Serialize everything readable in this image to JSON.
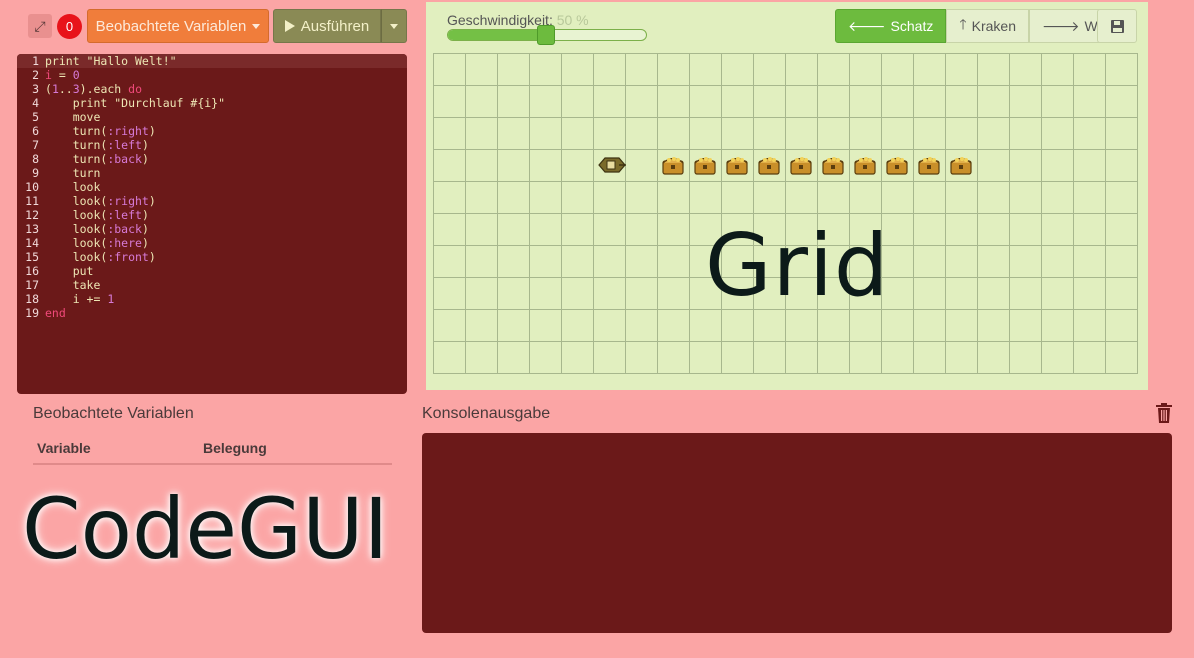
{
  "toolbar": {
    "error_count": "0",
    "watch_button_label": "Beobachtete Variablen",
    "run_button_label": "Ausführen"
  },
  "editor": {
    "lines": [
      {
        "n": "1",
        "html": "<span class=\"kw\"></span>print \"Hallo Welt!\""
      },
      {
        "n": "2",
        "html": "<span class=\"kw\">i</span> = <span class=\"num\">0</span>"
      },
      {
        "n": "3",
        "html": "(<span class=\"num\">1</span>..<span class=\"num\">3</span>).each <span class=\"kw\">do</span>"
      },
      {
        "n": "4",
        "html": "    print \"Durchlauf #{i}\""
      },
      {
        "n": "5",
        "html": "    move"
      },
      {
        "n": "6",
        "html": "    turn(<span class=\"sym\">:right</span>)"
      },
      {
        "n": "7",
        "html": "    turn(<span class=\"sym\">:left</span>)"
      },
      {
        "n": "8",
        "html": "    turn(<span class=\"sym\">:back</span>)"
      },
      {
        "n": "9",
        "html": "    turn"
      },
      {
        "n": "10",
        "html": "    look"
      },
      {
        "n": "11",
        "html": "    look(<span class=\"sym\">:right</span>)"
      },
      {
        "n": "12",
        "html": "    look(<span class=\"sym\">:left</span>)"
      },
      {
        "n": "13",
        "html": "    look(<span class=\"sym\">:back</span>)"
      },
      {
        "n": "14",
        "html": "    look(<span class=\"sym\">:here</span>)"
      },
      {
        "n": "15",
        "html": "    look(<span class=\"sym\">:front</span>)"
      },
      {
        "n": "16",
        "html": "    put"
      },
      {
        "n": "17",
        "html": "    take"
      },
      {
        "n": "18",
        "html": "    i += <span class=\"num\">1</span>"
      },
      {
        "n": "19",
        "html": "<span class=\"kw\">end</span>"
      }
    ]
  },
  "grid": {
    "speed_label": "Geschwindigkeit:",
    "speed_value": "50 %",
    "speed_fraction": 0.5,
    "buttons": {
      "treasure": "Schatz",
      "kraken": "Kraken",
      "wave": "Welle"
    },
    "watermark": "Grid",
    "treasure_count": 10
  },
  "watch": {
    "title": "Beobachtete Variablen",
    "col_variable": "Variable",
    "col_value": "Belegung"
  },
  "brand": "CodeGUI",
  "console": {
    "title": "Konsolenausgabe"
  },
  "colors": {
    "background": "#fba5a5",
    "editor_bg": "#6b1919",
    "grid_bg": "#e1efbf",
    "accent_green": "#6dbb3e",
    "watch_orange": "#f07d3b",
    "error_red": "#e8131a"
  }
}
